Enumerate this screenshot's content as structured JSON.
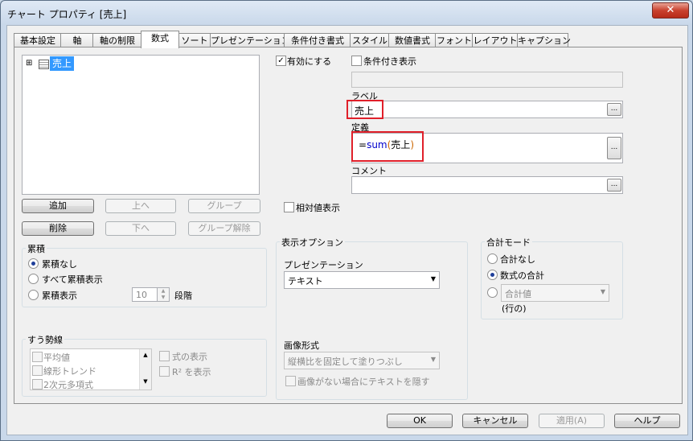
{
  "window": {
    "title": "チャート プロパティ [売上]",
    "close_label": "✕"
  },
  "tabs": [
    {
      "label": "基本設定"
    },
    {
      "label": "軸"
    },
    {
      "label": "軸の制限"
    },
    {
      "label": "数式"
    },
    {
      "label": "ソート"
    },
    {
      "label": "プレゼンテーション"
    },
    {
      "label": "条件付き書式"
    },
    {
      "label": "スタイル"
    },
    {
      "label": "数値書式"
    },
    {
      "label": "フォント"
    },
    {
      "label": "レイアウト"
    },
    {
      "label": "キャプション"
    }
  ],
  "active_tab": "数式",
  "expression_tree": {
    "expand_symbol": "⊞",
    "item_label": "売上"
  },
  "tree_buttons": {
    "add": "追加",
    "up": "上へ",
    "group": "グループ",
    "delete": "削除",
    "down": "下へ",
    "ungroup": "グループ解除"
  },
  "accumulation": {
    "title": "累積",
    "none": "累積なし",
    "all": "すべて累積表示",
    "show": "累積表示",
    "steps_value": "10",
    "steps_unit": "段階"
  },
  "trendline": {
    "title": "すう勢線",
    "items": [
      "平均値",
      "線形トレンド",
      "2次元多項式"
    ],
    "show_equation": "式の表示",
    "show_r2": "R² を表示"
  },
  "enable": {
    "label": "有効にする",
    "checked": "✓"
  },
  "conditional": {
    "label": "条件付き表示",
    "value": ""
  },
  "label_field": {
    "title": "ラベル",
    "value": "売上",
    "btn": "..."
  },
  "definition": {
    "title": "定義",
    "prefix": "=",
    "func": "sum",
    "open": "(",
    "arg": "売上",
    "close": ")",
    "btn": "..."
  },
  "comment": {
    "title": "コメント",
    "value": "",
    "btn": "..."
  },
  "relative": {
    "label": "相対値表示"
  },
  "display_options": {
    "title": "表示オプション",
    "presentation_label": "プレゼンテーション",
    "presentation_value": "テキスト",
    "image_format_label": "画像形式",
    "image_format_value": "縦横比を固定して塗りつぶし",
    "hide_text_label": "画像がない場合にテキストを隠す"
  },
  "total_mode": {
    "title": "合計モード",
    "none": "合計なし",
    "expression": "数式の合計",
    "combo_value": "合計値",
    "rows": "(行の)"
  },
  "footer": {
    "ok": "OK",
    "cancel": "キャンセル",
    "apply": "適用(A)",
    "help": "ヘルプ"
  },
  "colors": {
    "selection": "#3399ff",
    "highlight_border": "#e0202a",
    "func": "#0000cc",
    "paren": "#cc6600"
  }
}
